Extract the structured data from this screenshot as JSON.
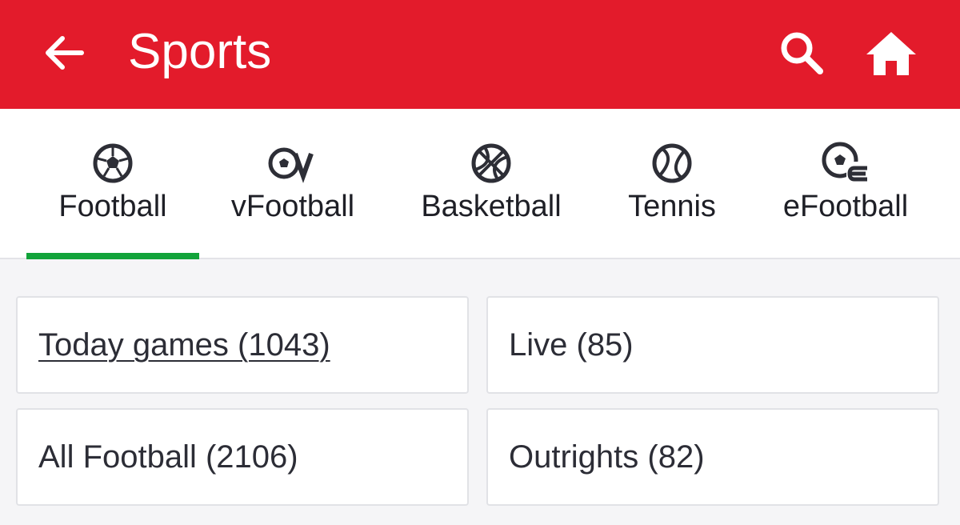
{
  "header": {
    "title": "Sports",
    "background_color": "#e31b2b",
    "back_icon": "arrow-left-icon",
    "search_icon": "search-icon",
    "home_icon": "home-icon"
  },
  "tabs": [
    {
      "label": "Football",
      "icon": "soccer-ball-icon",
      "selected": true
    },
    {
      "label": "vFootball",
      "icon": "virtual-football-icon",
      "selected": false
    },
    {
      "label": "Basketball",
      "icon": "basketball-icon",
      "selected": false
    },
    {
      "label": "Tennis",
      "icon": "tennis-ball-icon",
      "selected": false
    },
    {
      "label": "eFootball",
      "icon": "efootball-icon",
      "selected": false
    }
  ],
  "indicator_color": "#12a33a",
  "cards": [
    {
      "label": "Today games (1043)"
    },
    {
      "label": "Live (85)"
    },
    {
      "label": "All Football (2106)"
    },
    {
      "label": "Outrights (82)"
    }
  ]
}
